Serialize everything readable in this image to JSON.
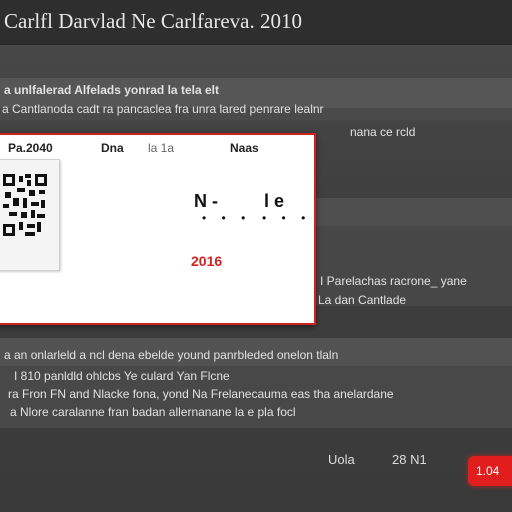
{
  "window": {
    "title": "Carlfl Darvlad Ne Carlfareva. 2010"
  },
  "content": {
    "lines_top": [
      "a unlfalerad Alfelads yonrad la tela elt",
      "a Cantlanoda cadt ra pancaclea fra unra lared penrare lealnr",
      "nana ce rcld"
    ],
    "lines_right": [
      "I Parelachas racrone_ yane",
      "La dan Cantlade"
    ],
    "lines_bottom": [
      "a an onlarleld a ncl dena ebelde yound panrbleded onelon tlaln",
      "I 810 panldld ohlcbs Ye culard Yan Flcne",
      "ra Fron FN and Nlacke fona, yond Na Frelanecauma eas tha anelardane",
      "a Nlore caralanne fran badan allernanane la e pla focl"
    ]
  },
  "card": {
    "headers": [
      "Pa.2040",
      "Dna",
      "la 1a",
      "Naas"
    ],
    "marker_left": "N  -",
    "marker_right": "l  e",
    "dots_left": "• • •",
    "dots_right": "• • •",
    "year": "2016",
    "colors": {
      "border": "#cc2222",
      "year": "#d42020"
    }
  },
  "footer": {
    "label": "Uola",
    "value": "28 N1",
    "button_label": "1.04"
  },
  "colors": {
    "accent": "#e01e1e",
    "background": "#3a3a3a"
  },
  "icons": [
    "qr-code-icon"
  ]
}
